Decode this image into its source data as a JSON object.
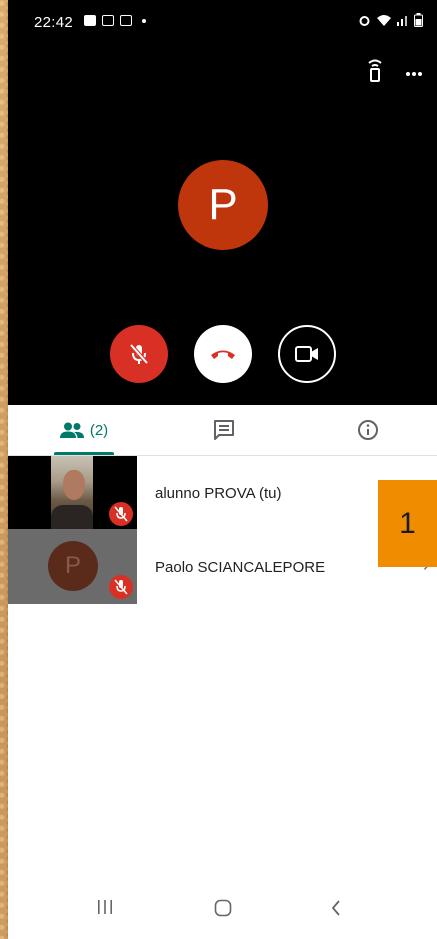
{
  "status_bar": {
    "time": "22:42",
    "left_icons": [
      "image-icon",
      "mail-icon",
      "mail-icon",
      "dot-icon"
    ],
    "right_icons": [
      "alarm-icon",
      "wifi-icon",
      "signal-icon",
      "battery-icon"
    ]
  },
  "call": {
    "top_actions": [
      "cast-icon",
      "more-icon"
    ],
    "avatar_letter": "P",
    "controls": [
      {
        "name": "mute-mic-button",
        "icon": "mic-off-icon"
      },
      {
        "name": "hang-up-button",
        "icon": "phone-hangup-icon"
      },
      {
        "name": "camera-button",
        "icon": "videocam-icon"
      }
    ]
  },
  "tabs": {
    "people_count": "(2)",
    "items": [
      "people-icon",
      "chat-icon",
      "info-icon"
    ]
  },
  "participants": [
    {
      "name": "alunno PROVA (tu)",
      "muted": true
    },
    {
      "name": "Paolo SCIANCALEPORE",
      "avatar_letter": "P",
      "muted": true
    }
  ],
  "overlay_badge": "1",
  "colors": {
    "accent": "#00796b",
    "mute_red": "#d93025",
    "avatar_bg": "#bf360c",
    "badge_orange": "#f08c00"
  },
  "nav": [
    "recent-apps-icon",
    "home-icon",
    "back-icon"
  ]
}
